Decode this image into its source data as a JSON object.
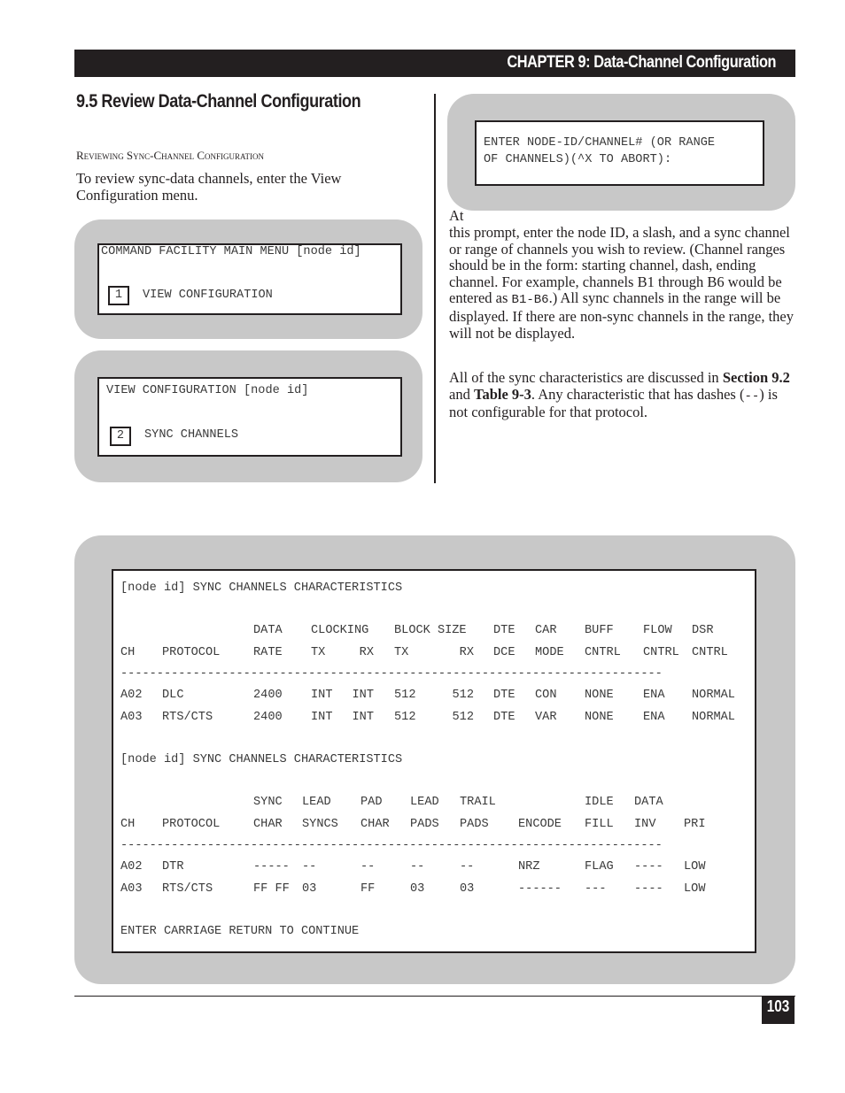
{
  "header": {
    "chapter_title": "CHAPTER 9: Data-Channel Configuration"
  },
  "section": {
    "title": "9.5  Review Data-Channel Configuration",
    "subhead": "Reviewing Sync-Channel Configuration",
    "intro": "To review sync-data channels, enter the View Configuration menu."
  },
  "screens": {
    "main_menu": {
      "title": "COMMAND FACILITY MAIN MENU [node id]",
      "key": "1",
      "option": "VIEW CONFIGURATION"
    },
    "view_config": {
      "title": "VIEW CONFIGURATION [node id]",
      "key": "2",
      "option": "SYNC CHANNELS"
    },
    "prompt": {
      "line1": "ENTER NODE-ID/CHANNEL# (OR RANGE",
      "line2": "OF CHANNELS)(^X TO ABORT):"
    }
  },
  "right_column": {
    "para1_at": "At",
    "para1_a": "this prompt, enter the node ID, a slash, and a sync channel or range of channels you wish to review. (Channel ranges should be in the form:  starting channel, dash, ending channel. For example, channels B1 through B6 would be entered as ",
    "para1_code": "B1-B6",
    "para1_b": ".)  All sync channels in the range will be displayed. If there are non-sync channels in the range, they will not be displayed.",
    "para2_a": "All of the sync characteristics are discussed in ",
    "para2_bold1": "Section 9.2",
    "para2_b": " and ",
    "para2_bold2": "Table 9-3",
    "para2_c": ". Any characteristic that has dashes (",
    "para2_code": "--",
    "para2_d": ") is not configurable for that protocol."
  },
  "characteristics_screen": {
    "table1": {
      "title": "[node id] SYNC CHANNELS CHARACTERISTICS",
      "header_row1": [
        "",
        "",
        "DATA",
        "CLOCKING",
        "",
        "BLOCK SIZE",
        "",
        "DTE",
        "CAR",
        "BUFF",
        "FLOW",
        "DSR"
      ],
      "header_row2": [
        "CH",
        "PROTOCOL",
        "RATE",
        "TX",
        "RX",
        "TX",
        "RX",
        "DCE",
        "MODE",
        "CNTRL",
        "CNTRL",
        "CNTRL"
      ],
      "divider": "---------------------------------------------------------------------------",
      "rows": [
        [
          "A02",
          "DLC",
          "2400",
          "INT",
          "INT",
          "512",
          "512",
          "DTE",
          "CON",
          "NONE",
          "ENA",
          "NORMAL"
        ],
        [
          "A03",
          "RTS/CTS",
          "2400",
          "INT",
          "INT",
          "512",
          "512",
          "DTE",
          "VAR",
          "NONE",
          "ENA",
          "NORMAL"
        ]
      ]
    },
    "table2": {
      "title": "[node id] SYNC CHANNELS CHARACTERISTICS",
      "header_row1": [
        "",
        "",
        "SYNC",
        "LEAD",
        "PAD",
        "LEAD",
        "TRAIL",
        "",
        "IDLE",
        "DATA",
        ""
      ],
      "header_row2": [
        "CH",
        "PROTOCOL",
        "CHAR",
        "SYNCS",
        "CHAR",
        "PADS",
        "PADS",
        "ENCODE",
        "FILL",
        "INV",
        "PRI"
      ],
      "divider": "---------------------------------------------------------------------------",
      "rows": [
        [
          "A02",
          "DTR",
          "-----",
          "--",
          "--",
          "--",
          "--",
          "NRZ",
          "FLAG",
          "----",
          "LOW"
        ],
        [
          "A03",
          "RTS/CTS",
          "FF FF",
          "03",
          "FF",
          "03",
          "03",
          "------",
          "---",
          "----",
          "LOW"
        ]
      ]
    },
    "footer_prompt": "ENTER CARRIAGE RETURN TO CONTINUE"
  },
  "footer": {
    "page_number": "103"
  }
}
